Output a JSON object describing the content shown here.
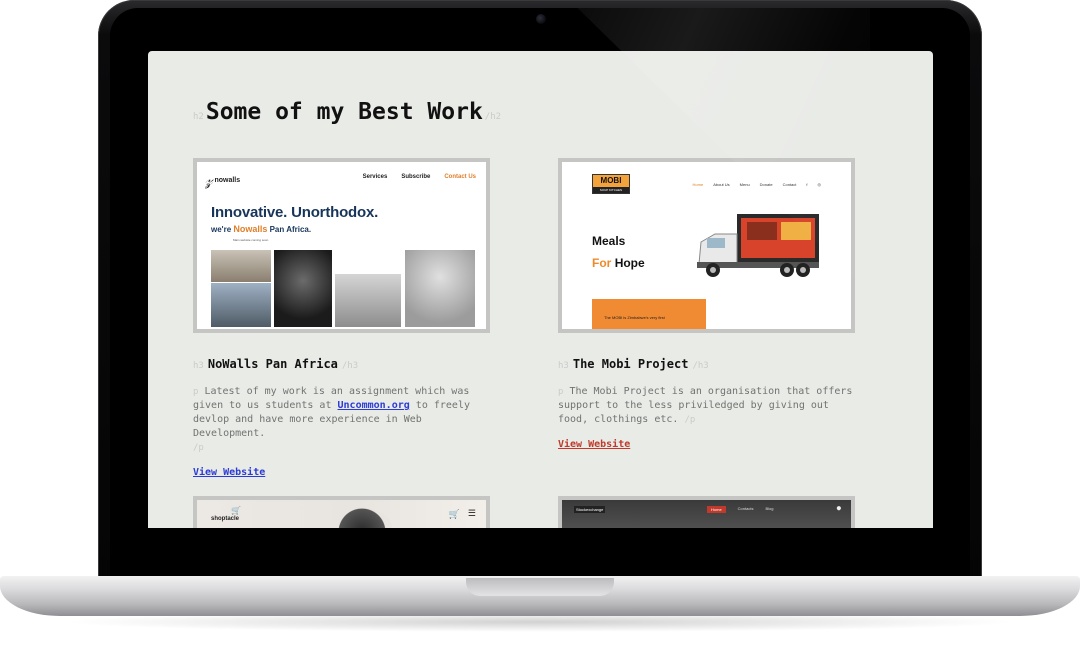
{
  "section": {
    "tag_open": "h2",
    "title": "Some of my Best Work",
    "tag_close": "/h2"
  },
  "projects": [
    {
      "tag_open": "h3",
      "title": "NoWalls Pan Africa",
      "tag_close": "/h3",
      "desc_tag": "p",
      "desc_before": "Latest of my work is an assignment which was given to us students at",
      "desc_link": "Uncommon.org",
      "desc_after": "to freely devlop and have more experience in Web Development.",
      "desc_tag_close": "/p",
      "link_label": "View Website",
      "link_color": "#2b3bd6",
      "thumbnail": {
        "logo_mark": "𝓏",
        "logo_name": "nowalls",
        "nav": [
          "Services",
          "Subscribe",
          "Contact Us"
        ],
        "headline": "Innovative. Unorthodox.",
        "sub_prefix": "we're ",
        "sub_brand": "Nowalls",
        "sub_suffix": " Pan Africa.",
        "small_text": "Main website coming soon"
      }
    },
    {
      "tag_open": "h3",
      "title": "The Mobi Project",
      "tag_close": "/h3",
      "desc_tag": "p",
      "desc_text": "The Mobi Project is an organisation that offers support to the less priviledged by giving out food, clothings etc.",
      "desc_tag_close": "/p",
      "link_label": "View Website",
      "link_color": "#c0392b",
      "thumbnail": {
        "logo_top": "MOBI",
        "logo_bottom": "SOUP KITCHEN",
        "nav": [
          "Home",
          "About Us",
          "Menu",
          "Donate",
          "Contact"
        ],
        "headline_line1": "Meals",
        "headline_for": "For",
        "headline_hope": "Hope",
        "banner_text": "The MOBI is Zimbabwe's very first"
      }
    }
  ],
  "lower_cards": [
    {
      "name": "shoptacle"
    },
    {
      "name": "Stockexchange",
      "nav": [
        "Home",
        "Contacts",
        "Blog"
      ]
    }
  ],
  "colors": {
    "screen_bg": "#e9ebe7",
    "accent_orange": "#e0802a",
    "link_blue": "#2b3bd6",
    "link_red": "#c0392b"
  }
}
